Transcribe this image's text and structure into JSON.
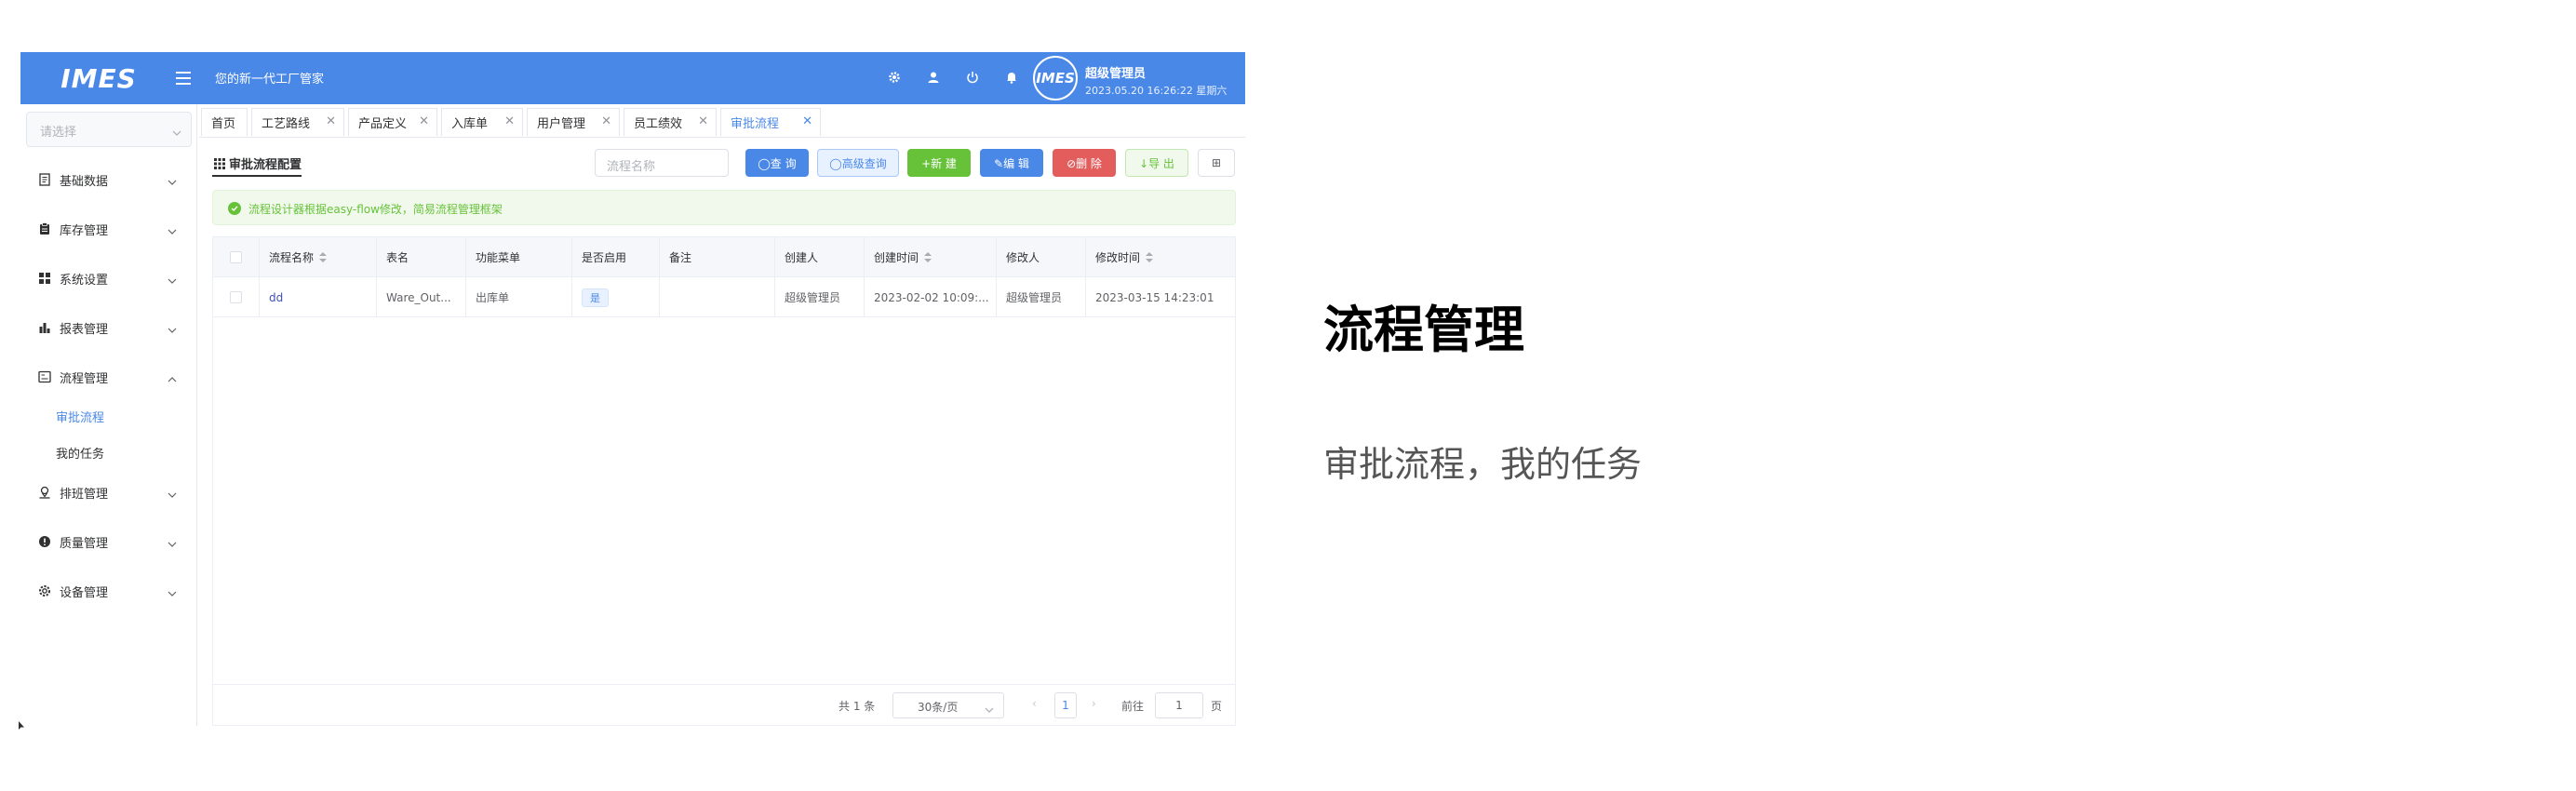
{
  "header": {
    "logo_text": "IMES",
    "slogan": "您的新一代工厂管家",
    "avatar_text": "IMES",
    "user_name": "超级管理员",
    "datetime": "2023.05.20 16:26:22 星期六"
  },
  "sidebar": {
    "select_placeholder": "请选择",
    "items": [
      {
        "label": "基础数据",
        "icon": "document-icon"
      },
      {
        "label": "库存管理",
        "icon": "clipboard-icon"
      },
      {
        "label": "系统设置",
        "icon": "grid-icon"
      },
      {
        "label": "报表管理",
        "icon": "bar-chart-icon"
      },
      {
        "label": "流程管理",
        "icon": "flow-icon"
      },
      {
        "label": "排班管理",
        "icon": "location-icon"
      },
      {
        "label": "质量管理",
        "icon": "alert-icon"
      },
      {
        "label": "设备管理",
        "icon": "gear-icon"
      }
    ],
    "sub_items": [
      {
        "label": "审批流程",
        "active": true
      },
      {
        "label": "我的任务",
        "active": false
      }
    ]
  },
  "tabs": [
    {
      "label": "首页",
      "closable": false
    },
    {
      "label": "工艺路线",
      "closable": true
    },
    {
      "label": "产品定义",
      "closable": true
    },
    {
      "label": "入库单",
      "closable": true
    },
    {
      "label": "用户管理",
      "closable": true
    },
    {
      "label": "员工绩效",
      "closable": true
    },
    {
      "label": "审批流程",
      "closable": true,
      "active": true
    }
  ],
  "main": {
    "title": "审批流程配置",
    "search_placeholder": "流程名称",
    "buttons": {
      "query": "◯查 询",
      "advanced": "◯高级查询",
      "new": "+新 建",
      "edit": "✎编 辑",
      "delete": "⊘删 除",
      "export": "↓导 出",
      "columns": "⊞"
    },
    "alert": "流程设计器根据easy-flow修改，简易流程管理框架"
  },
  "table": {
    "headers": [
      "流程名称",
      "表名",
      "功能菜单",
      "是否启用",
      "备注",
      "创建人",
      "创建时间",
      "修改人",
      "修改时间"
    ],
    "rows": [
      {
        "name": "dd",
        "table_name": "Ware_Out...",
        "menu": "出库单",
        "enabled": "是",
        "remark": "",
        "creator": "超级管理员",
        "created": "2023-02-02 10:09:...",
        "modifier": "超级管理员",
        "modified": "2023-03-15 14:23:01"
      }
    ]
  },
  "pager": {
    "total": "共 1 条",
    "page_size": "30条/页",
    "prev": "‹",
    "current": "1",
    "next": "›",
    "goto": "前往",
    "goto_value": "1",
    "page_suffix": "页"
  },
  "slide": {
    "title": "流程管理",
    "subtitle": "审批流程，我的任务"
  },
  "colors": {
    "primary": "#4a88e8",
    "success": "#67c23a",
    "danger": "#e35d5d"
  }
}
